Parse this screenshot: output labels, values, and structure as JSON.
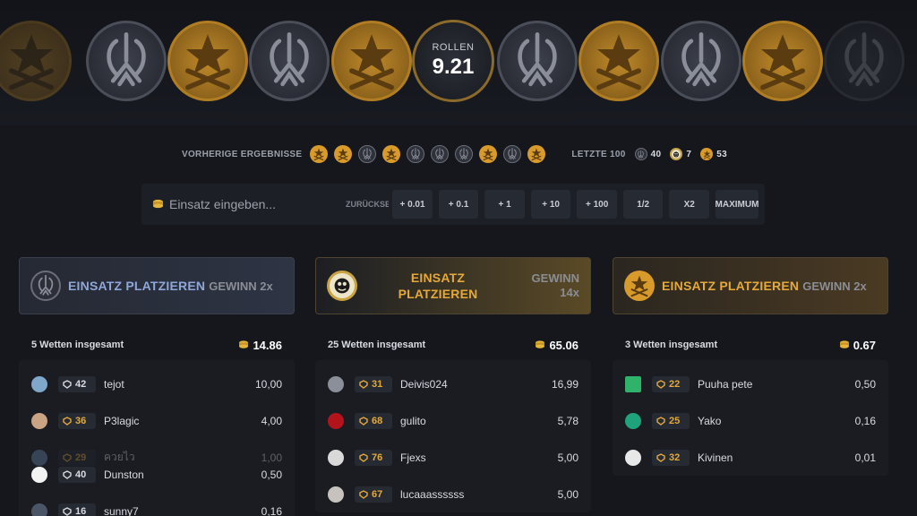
{
  "roll": {
    "label": "ROLLEN",
    "value": "9.21"
  },
  "strip": {
    "coins": [
      "t",
      "ct",
      "t",
      "ct",
      "t",
      "ct",
      "t",
      "ct",
      "t",
      "ct"
    ]
  },
  "previous": {
    "label": "VORHERIGE ERGEBNISSE",
    "results": [
      "t",
      "t",
      "ct",
      "t",
      "ct",
      "ct",
      "ct",
      "t",
      "ct",
      "t"
    ],
    "last_label": "LETZTE 100",
    "counts": {
      "ct": "40",
      "bonus": "7",
      "t": "53"
    }
  },
  "bet": {
    "placeholder": "Einsatz eingeben...",
    "clear_label": "ZURÜCKSETZEN",
    "buttons": [
      "+ 0.01",
      "+ 0.1",
      "+ 1",
      "+ 10",
      "+ 100",
      "1/2",
      "X2",
      "MAXIMUM"
    ]
  },
  "columns": [
    {
      "place_label": "EINSATZ PLATZIEREN",
      "win_label": "GEWINN 2x",
      "bets_label": "5 Wetten insgesamt",
      "total": "14.86",
      "rows": [
        {
          "level": "42",
          "name": "tejot",
          "amount": "10,00"
        },
        {
          "level": "36",
          "name": "P3lagic",
          "amount": "4,00"
        },
        {
          "level": "29",
          "name": "ควยไว",
          "amount": "1,00"
        },
        {
          "level": "40",
          "name": "Dunston",
          "amount": "0,50"
        },
        {
          "level": "16",
          "name": "sunny7",
          "amount": "0,16"
        }
      ]
    },
    {
      "place_label": "EINSATZ PLATZIEREN",
      "win_label": "GEWINN 14x",
      "bets_label": "25 Wetten insgesamt",
      "total": "65.06",
      "rows": [
        {
          "level": "31",
          "name": "Deivis024",
          "amount": "16,99"
        },
        {
          "level": "68",
          "name": "gulito",
          "amount": "5,78"
        },
        {
          "level": "76",
          "name": "Fjexs",
          "amount": "5,00"
        },
        {
          "level": "67",
          "name": "lucaaassssss",
          "amount": "5,00"
        }
      ]
    },
    {
      "place_label": "EINSATZ PLATZIEREN",
      "win_label": "GEWINN 2x",
      "bets_label": "3 Wetten insgesamt",
      "total": "0.67",
      "rows": [
        {
          "level": "22",
          "name": "Puuha pete",
          "amount": "0,50"
        },
        {
          "level": "25",
          "name": "Yako",
          "amount": "0,16"
        },
        {
          "level": "32",
          "name": "Kivinen",
          "amount": "0,01"
        }
      ]
    }
  ],
  "colors": {
    "gold": "#e5a93a",
    "ct_blue": "#8fa6d8",
    "background": "#15171d"
  }
}
